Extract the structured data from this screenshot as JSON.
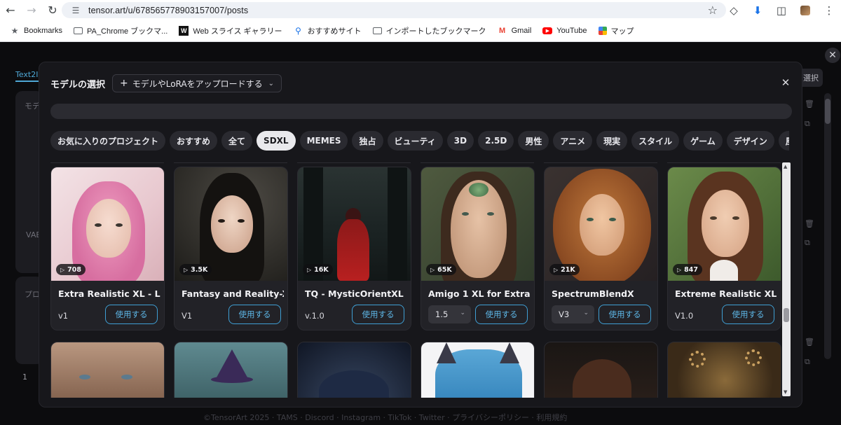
{
  "browser": {
    "url": "tensor.art/u/678565778903157007/posts",
    "bookmarks": [
      {
        "label": "Bookmarks",
        "icon": "star-icon"
      },
      {
        "label": "PA_Chrome ブックマ...",
        "icon": "folder-icon"
      },
      {
        "label": "Web スライス ギャラリー",
        "icon": "web-slice-icon"
      },
      {
        "label": "おすすめサイト",
        "icon": "search-icon"
      },
      {
        "label": "インポートしたブックマーク",
        "icon": "folder-icon"
      },
      {
        "label": "Gmail",
        "icon": "gmail-icon"
      },
      {
        "label": "YouTube",
        "icon": "youtube-icon"
      },
      {
        "label": "マップ",
        "icon": "maps-icon"
      }
    ]
  },
  "background": {
    "tab_label": "Text2Im",
    "model_label": "モデ",
    "vae_label": "VAE",
    "prompt_label": "プロ",
    "count_value": "1",
    "right_button_label": "選択",
    "footer_text": "©TensorArt 2025 · TAMS · Discord · Instagram · TikTok · Twitter · プライバシーポリシー · 利用規約"
  },
  "modal": {
    "title": "モデルの選択",
    "upload_button": "モデルやLoRAをアップロードする",
    "search_placeholder": "",
    "categories": [
      {
        "label": "お気に入りのプロジェクト",
        "active": false
      },
      {
        "label": "おすすめ",
        "active": false
      },
      {
        "label": "全て",
        "active": false
      },
      {
        "label": "SDXL",
        "active": true
      },
      {
        "label": "MEMES",
        "active": false
      },
      {
        "label": "独占",
        "active": false
      },
      {
        "label": "ビューティ",
        "active": false
      },
      {
        "label": "3D",
        "active": false
      },
      {
        "label": "2.5D",
        "active": false
      },
      {
        "label": "男性",
        "active": false
      },
      {
        "label": "アニメ",
        "active": false
      },
      {
        "label": "現実",
        "active": false
      },
      {
        "label": "スタイル",
        "active": false
      },
      {
        "label": "ゲーム",
        "active": false
      },
      {
        "label": "デザイン",
        "active": false
      },
      {
        "label": "風景",
        "active": false
      },
      {
        "label": "建",
        "active": false
      }
    ],
    "use_button_label": "使用する",
    "cards": [
      {
        "name": "Extra Realistic XL - LC...",
        "runs": "708",
        "version": "v1",
        "has_select": false,
        "thumb": "pink-hair-portrait"
      },
      {
        "name": "Fantasy and Reality-X...",
        "runs": "3.5K",
        "version": "V1",
        "has_select": false,
        "thumb": "dark-hair-portrait"
      },
      {
        "name": "TQ - MysticOrientXL (...",
        "runs": "16K",
        "version": "v.1.0",
        "has_select": false,
        "thumb": "red-robed-figure"
      },
      {
        "name": "Amigo 1 XL for Extra R...",
        "runs": "65K",
        "version": "1.5",
        "has_select": true,
        "thumb": "forehead-jewel-portrait"
      },
      {
        "name": "SpectrumBlendX",
        "runs": "21K",
        "version": "V3",
        "has_select": true,
        "thumb": "curly-hair-portrait"
      },
      {
        "name": "Extreme Realistic XL",
        "runs": "847",
        "version": "V1.0",
        "has_select": false,
        "thumb": "woman-with-cat-portrait"
      }
    ]
  },
  "colors": {
    "accent": "#3f9fd4",
    "modal_bg": "#17171b",
    "card_bg": "#222227",
    "chip_bg": "#2a2a30",
    "chip_active_bg": "#e9e9ec"
  }
}
